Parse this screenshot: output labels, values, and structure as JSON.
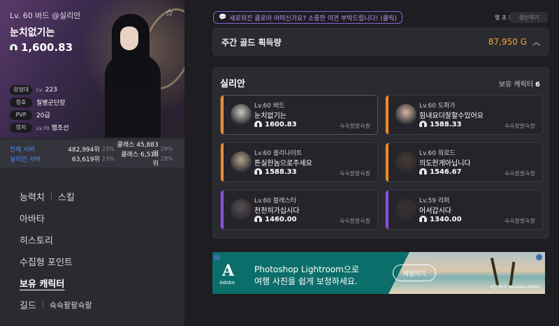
{
  "profile": {
    "subtitle": "Lv. 60 바드 @실리안",
    "name": "눈치없기는",
    "item_level": "1,600.83",
    "info": [
      {
        "tag": "원정대",
        "prefix": "Lv.",
        "value": "223"
      },
      {
        "tag": "칭호",
        "prefix": "",
        "value": "질병군단장"
      },
      {
        "tag": "PVP",
        "prefix": "",
        "value": "20급"
      },
      {
        "tag": "영지",
        "prefix": "Lv.70",
        "value": "햄조선"
      }
    ]
  },
  "ranking": [
    {
      "label": "전체 서버",
      "rank": "482,994위",
      "pct": "23%",
      "class_rank": "클래스 45,883위",
      "class_pct": "29%"
    },
    {
      "label": "실리안 서버",
      "rank": "63,619위",
      "pct": "23%",
      "class_rank": "클래스 6,510위",
      "class_pct": "29%"
    }
  ],
  "menu": {
    "ability": "능력치",
    "skill": "스킬",
    "avatar": "아바타",
    "history": "히스토리",
    "collect": "수집형 포인트",
    "roster": "보유 캐릭터",
    "guild": "길드",
    "guild_name": "슉슉팔팔슉팔"
  },
  "notice": "새로워진 클로아 어떠신가요? 소중한 의견 부탁드립니다! (클릭)",
  "updated": "몇 초 전",
  "refresh": "갱신하기",
  "gold": {
    "title": "주간 골드 획득량",
    "value": "87,950 G"
  },
  "roster": {
    "server": "실리안",
    "count_label": "보유 캐릭터",
    "count": "6",
    "characters": [
      {
        "class": "Lv.60 바드",
        "name": "눈치없기는",
        "level": "1600.83",
        "guild": "슉슉팔팔슉팔",
        "stripe": "#f08a2a",
        "avatar": "#cfc8c4"
      },
      {
        "class": "Lv.60 도화가",
        "name": "힘내요더잘할수있어요",
        "level": "1588.33",
        "guild": "슉슉팔팔슉팔",
        "stripe": "#f08a2a",
        "avatar": "#d9b7a9"
      },
      {
        "class": "Lv.60 홀리나이트",
        "name": "튼실한놈으로주세요",
        "level": "1588.33",
        "guild": "슉슉팔팔슉팔",
        "stripe": "#f08a2a",
        "avatar": "#b7a58c"
      },
      {
        "class": "Lv.60 워로드",
        "name": "의도한게아닙니다",
        "level": "1546.67",
        "guild": "슉슉팔팔슉팔",
        "stripe": "#f08a2a",
        "avatar": "#4a3a32"
      },
      {
        "class": "Lv.60 블래스터",
        "name": "천천히가십시다",
        "level": "1460.00",
        "guild": "슉슉팔팔슉팔",
        "stripe": "#8d4fe0",
        "avatar": "#5a5050"
      },
      {
        "class": "Lv.59 리퍼",
        "name": "어서갑시다",
        "level": "1340.00",
        "guild": "슉슉팔팔슉팔",
        "stripe": "#8d4fe0",
        "avatar": "#3a2e30"
      }
    ]
  },
  "ad": {
    "brand": "Adobe",
    "title1": "Photoshop Lightroom으로",
    "title2": "여행 사진을 쉽게 보정하세요.",
    "button": "체험하기",
    "credit": "사진 제공: Vanessa Martin"
  }
}
